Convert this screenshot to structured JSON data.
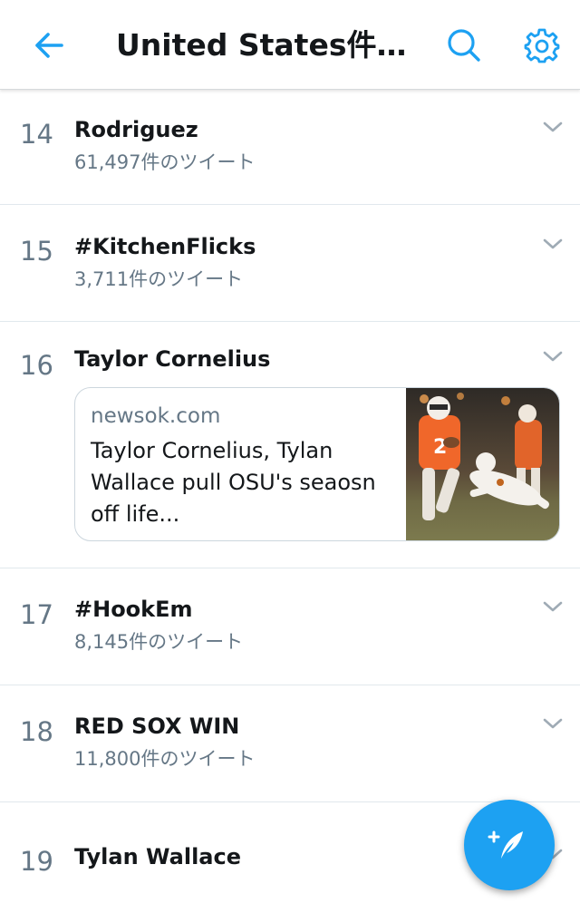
{
  "header": {
    "title": "United States件の…",
    "back_icon": "arrow-left-icon",
    "search_icon": "search-icon",
    "settings_icon": "gear-icon",
    "accent_color": "#1da1f2"
  },
  "trends": [
    {
      "rank": "14",
      "name": "Rodriguez",
      "count": "61,497件のツイート"
    },
    {
      "rank": "15",
      "name": "#KitchenFlicks",
      "count": "3,711件のツイート"
    },
    {
      "rank": "16",
      "name": "Taylor Cornelius",
      "card": {
        "domain": "newsok.com",
        "text": "Taylor Cornelius, Tylan Wallace pull OSU's seaosn off life..."
      }
    },
    {
      "rank": "17",
      "name": "#HookEm",
      "count": "8,145件のツイート"
    },
    {
      "rank": "18",
      "name": "RED SOX WIN",
      "count": "11,800件のツイート"
    },
    {
      "rank": "19",
      "name": "Tylan Wallace"
    }
  ],
  "fab": {
    "icon": "compose-tweet-icon"
  }
}
